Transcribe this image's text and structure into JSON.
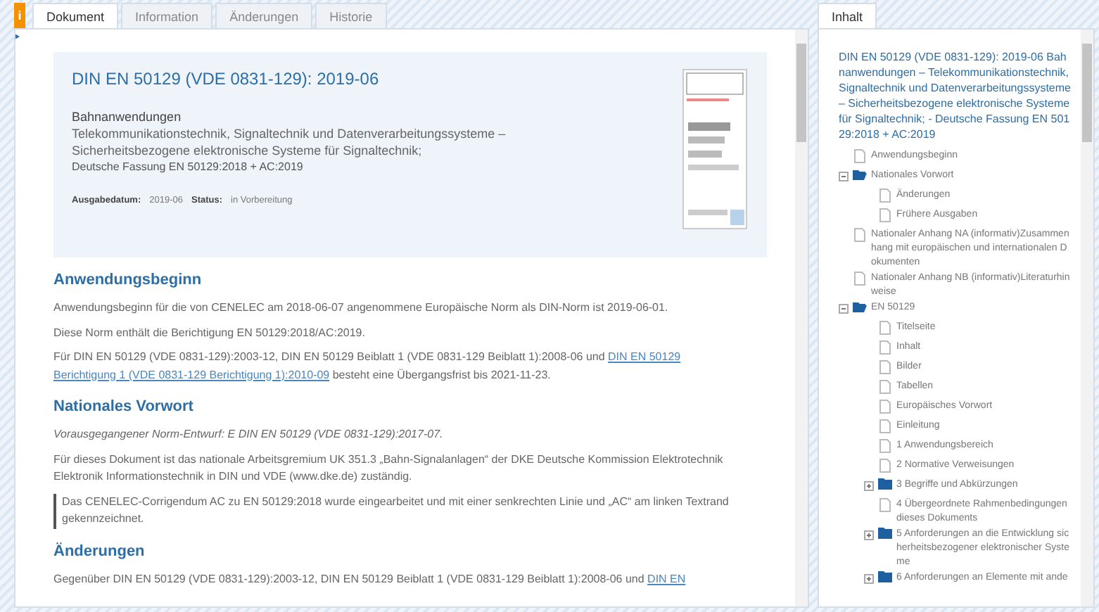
{
  "left_panel": {
    "info_badge": "i",
    "tabs": [
      {
        "label": "Dokument",
        "selected": true
      },
      {
        "label": "Information",
        "selected": false
      },
      {
        "label": "Änderungen",
        "selected": false
      },
      {
        "label": "Historie",
        "selected": false
      }
    ],
    "header": {
      "title": "DIN EN 50129 (VDE 0831-129): 2019-06",
      "subtitle": "Bahnanwendungen",
      "description": [
        "Telekommunikationstechnik, Signaltechnik und Datenverarbeitungssysteme –",
        "Sicherheitsbezogene elektronische Systeme für Signaltechnik;"
      ],
      "version": "Deutsche Fassung EN 50129:2018 + AC:2019",
      "meta": [
        {
          "label": "Ausgabedatum:",
          "value": "2019-06"
        },
        {
          "label": "Status:",
          "value": "in Vorbereitung"
        }
      ],
      "thumbnail": {
        "kind": "picture"
      }
    },
    "sections": [
      {
        "heading": "Anwendungsbeginn",
        "paragraphs": [
          {
            "kind": "plain",
            "parts": [
              {
                "kind": "text",
                "text": "Anwendungsbeginn für die von CENELEC am 2018-06-07 angenommene Europäische Norm als DIN-Norm ist 2019-06-01."
              }
            ]
          },
          {
            "kind": "plain",
            "parts": [
              {
                "kind": "text",
                "text": "Diese Norm enthält die Berichtigung EN 50129:2018/AC:2019."
              }
            ]
          },
          {
            "kind": "plain",
            "parts": [
              {
                "kind": "text",
                "text": "Für DIN EN 50129 (VDE 0831-129):2003-12, DIN EN 50129 Beiblatt 1 (VDE 0831-129 Beiblatt 1):2008-06 und "
              },
              {
                "kind": "link",
                "text": "DIN EN 50129"
              },
              {
                "kind": "gap"
              },
              {
                "kind": "link",
                "text": "Berichtigung 1 (VDE 0831-129 Berichtigung 1):2010-09"
              },
              {
                "kind": "text",
                "text": " besteht eine Übergangsfrist bis 2021-11-23."
              }
            ]
          }
        ]
      },
      {
        "heading": "Nationales Vorwort",
        "paragraphs": [
          {
            "kind": "italic",
            "parts": [
              {
                "kind": "text",
                "text": "Vorausgegangener Norm-Entwurf: E DIN EN 50129 (VDE 0831-129):2017-07."
              }
            ]
          },
          {
            "kind": "plain",
            "parts": [
              {
                "kind": "text",
                "text": "Für dieses Dokument ist das nationale Arbeitsgremium UK 351.3 „Bahn-Signalanlagen“ der DKE  Deutsche Kommission Elektrotechnik Elektronik Informationstechnik in DIN und VDE (www.dke.de) zuständig."
              }
            ]
          },
          {
            "kind": "marked",
            "parts": [
              {
                "kind": "text",
                "text": "Das CENELEC-Corrigendum AC zu EN 50129:2018 wurde eingearbeitet und mit einer senkrechten Linie und „AC“ am linken Textrand gekennzeichnet."
              }
            ]
          }
        ]
      },
      {
        "heading": "Änderungen",
        "paragraphs": [
          {
            "kind": "plain",
            "parts": [
              {
                "kind": "text",
                "text": "Gegenüber DIN EN 50129 (VDE 0831-129):2003-12, DIN EN 50129 Beiblatt 1 (VDE 0831-129 Beiblatt 1):2008-06 und "
              },
              {
                "kind": "link",
                "text": "DIN EN"
              }
            ]
          }
        ]
      }
    ]
  },
  "right_panel": {
    "tabs": [
      {
        "label": "Inhalt",
        "selected": true
      }
    ],
    "title": "DIN EN 50129 (VDE 0831-129): 2019-06 Bahnanwendungen – Telekommunikationstechnik, Signaltechnik und Datenverarbeitungssysteme – Sicherheitsbezogene elektronische Systeme für Signaltechnik; - Deutsche Fassung EN 50129:2018 + AC:2019",
    "tree": [
      {
        "kind": "page",
        "label": "Anwendungsbeginn"
      },
      {
        "kind": "folder",
        "label": "Nationales Vorwort",
        "expanded": true,
        "children": [
          {
            "kind": "page",
            "label": "Änderungen"
          },
          {
            "kind": "page",
            "label": "Frühere Ausgaben"
          }
        ]
      },
      {
        "kind": "page",
        "label": "Nationaler Anhang NA (informativ)Zusammenhang mit europäischen und internationalen Dokumenten"
      },
      {
        "kind": "page",
        "label": "Nationaler Anhang NB (informativ)Literaturhinweise"
      },
      {
        "kind": "folder",
        "label": "EN 50129",
        "expanded": true,
        "children": [
          {
            "kind": "page",
            "label": "Titelseite"
          },
          {
            "kind": "page",
            "label": "Inhalt"
          },
          {
            "kind": "page",
            "label": "Bilder"
          },
          {
            "kind": "page",
            "label": "Tabellen"
          },
          {
            "kind": "page",
            "label": "Europäisches Vorwort"
          },
          {
            "kind": "page",
            "label": "Einleitung"
          },
          {
            "kind": "page",
            "label": "1 Anwendungsbereich"
          },
          {
            "kind": "page",
            "label": "2 Normative Verweisungen"
          },
          {
            "kind": "folder",
            "label": "3 Begriffe und Abkürzungen",
            "expanded": false
          },
          {
            "kind": "page",
            "label": "4 Übergeordnete Rahmenbedingungen dieses Dokuments"
          },
          {
            "kind": "folder",
            "label": "5 Anforderungen an die Entwicklung sicherheitsbezogener elektronischer Systeme",
            "expanded": false
          },
          {
            "kind": "folder",
            "label": "6 Anforderungen an Elemente mit ande",
            "expanded": false
          }
        ]
      }
    ]
  }
}
